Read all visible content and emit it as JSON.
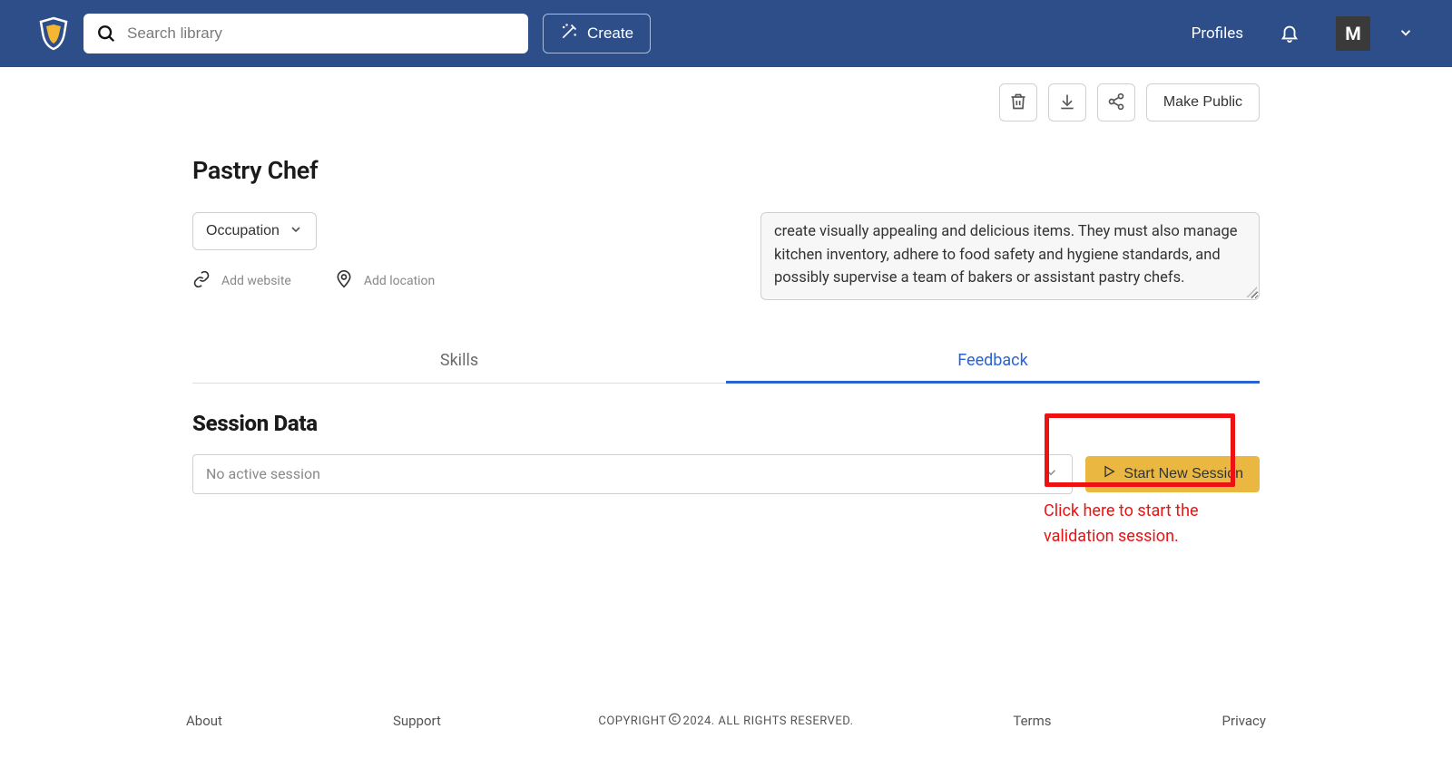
{
  "header": {
    "search_placeholder": "Search library",
    "create_label": "Create",
    "nav_link": "Profiles",
    "avatar_initial": "M"
  },
  "actions": {
    "make_public_label": "Make Public"
  },
  "profile": {
    "title": "Pastry Chef",
    "occupation_label": "Occupation",
    "add_website_label": "Add website",
    "add_location_label": "Add location",
    "description": "create visually appealing and delicious items. They must also manage kitchen inventory, adhere to food safety and hygiene standards, and possibly supervise a team of bakers or assistant pastry chefs."
  },
  "tabs": {
    "skills": "Skills",
    "feedback": "Feedback"
  },
  "session": {
    "heading": "Session Data",
    "placeholder": "No active session",
    "start_label": "Start New Session"
  },
  "annotation": {
    "text": "Click here to start the validation session."
  },
  "footer": {
    "about": "About",
    "support": "Support",
    "copyright_prefix": "COPYRIGHT ",
    "copyright_suffix": " 2024. ALL RIGHTS RESERVED.",
    "terms": "Terms",
    "privacy": "Privacy"
  }
}
